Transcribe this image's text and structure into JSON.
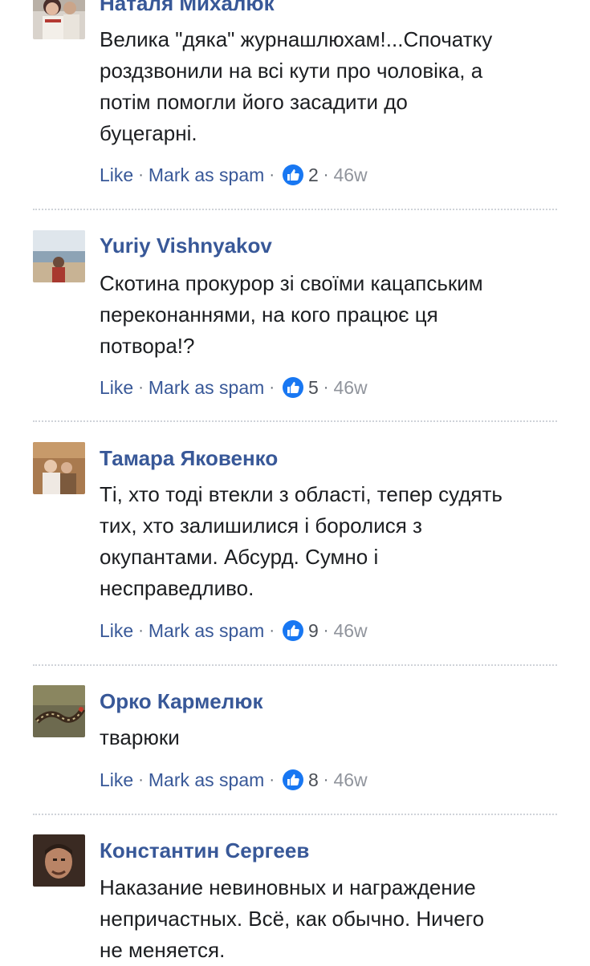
{
  "comments": [
    {
      "author": "Наталя Михалюк",
      "text": "Велика \"дяка\" журнашлюхам!...Спочатку\nроздзвонили на всі кути про чоловіка, а\nпотім помогли його засадити до\nбуцегарні.",
      "like_label": "Like",
      "spam_label": "Mark as spam",
      "reactions": "2",
      "time": "46w"
    },
    {
      "author": "Yuriy Vishnyakov",
      "text": "Скотина прокурор зі своїми кацапським\nпереконаннями, на кого працює ця\nпотвора!?",
      "like_label": "Like",
      "spam_label": "Mark as spam",
      "reactions": "5",
      "time": "46w"
    },
    {
      "author": "Тамара Яковенко",
      "text": "Ті, хто тоді втекли з області, тепер судять\nтих, хто залишилися і боролися з\nокупантами. Абсурд. Сумно і\nнесправедливо.",
      "like_label": "Like",
      "spam_label": "Mark as spam",
      "reactions": "9",
      "time": "46w"
    },
    {
      "author": "Орко Кармелюк",
      "text": "тварюки",
      "like_label": "Like",
      "spam_label": "Mark as spam",
      "reactions": "8",
      "time": "46w"
    },
    {
      "author": "Константин Сергеев",
      "text": "Наказание невиновных и награждение\nнепричастных. Всё, как обычно. Ничего\nне меняется."
    }
  ],
  "separator": "·",
  "colors": {
    "link": "#385898",
    "text": "#1c1e21",
    "meta": "#90949c",
    "like_badge": "#1877f2"
  },
  "icons": {
    "reaction": "thumbs-up-icon"
  }
}
